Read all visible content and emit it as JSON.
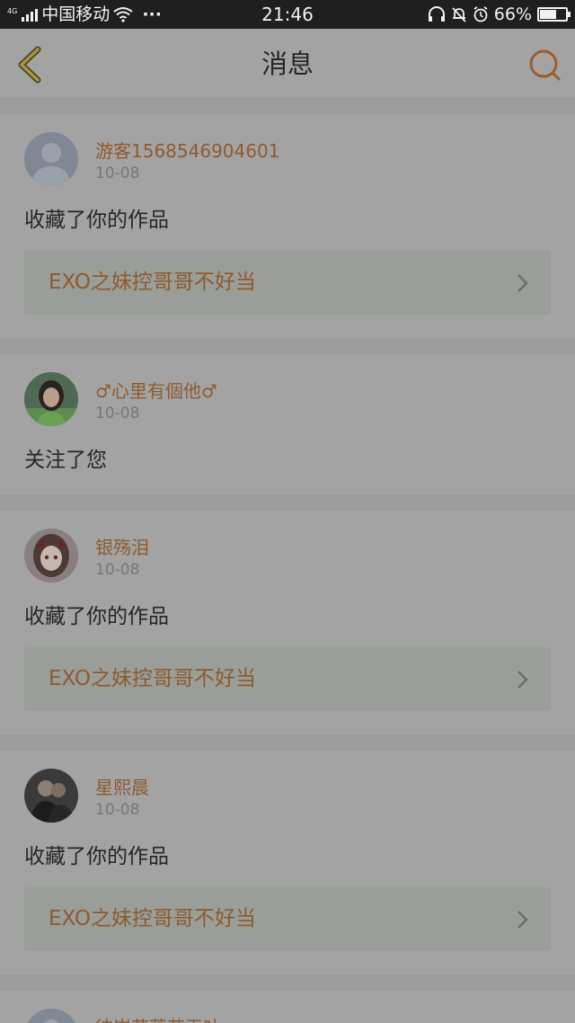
{
  "status_bar": {
    "network": "4G",
    "carrier": "中国移动",
    "dots": "···",
    "time": "21:46",
    "battery_percent_text": "66%",
    "battery_level": 0.66
  },
  "nav": {
    "title": "消息",
    "back_icon": "chevron-left-icon",
    "search_icon": "search-icon",
    "accent_color": "#8e5a2f"
  },
  "messages": [
    {
      "user": "游客1568546904601",
      "date": "10-08",
      "action": "收藏了你的作品",
      "work": "EXO之妹控哥哥不好当",
      "avatar": "default-avatar"
    },
    {
      "user": "♂心里有個他♂",
      "date": "10-08",
      "action": "关注了您",
      "avatar": "photo-avatar"
    },
    {
      "user": "银殇泪",
      "date": "10-08",
      "action": "收藏了你的作品",
      "work": "EXO之妹控哥哥不好当",
      "avatar": "anime-avatar"
    },
    {
      "user": "星熙晨",
      "date": "10-08",
      "action": "收藏了你的作品",
      "work": "EXO之妹控哥哥不好当",
      "avatar": "photo-avatar"
    },
    {
      "user": "彼岸花落花无叶",
      "avatar": "default-avatar"
    }
  ]
}
